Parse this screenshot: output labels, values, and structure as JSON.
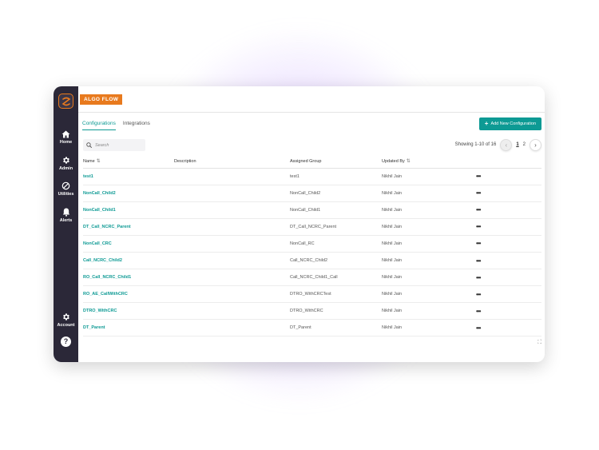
{
  "app": {
    "brand": "ALGO FLOW"
  },
  "sidebar": {
    "items": [
      {
        "label": "Home",
        "icon": "home-icon"
      },
      {
        "label": "Admin",
        "icon": "gear-icon"
      },
      {
        "label": "Utilities",
        "icon": "utilities-icon"
      },
      {
        "label": "Alerts",
        "icon": "bell-icon"
      }
    ],
    "account": {
      "label": "Account",
      "icon": "gear-icon"
    },
    "help": {
      "label": "?",
      "icon": "help-icon"
    }
  },
  "tabs": [
    {
      "label": "Configurations",
      "active": true
    },
    {
      "label": "Integrations",
      "active": false
    }
  ],
  "toolbar": {
    "add_label": "Add New Configuration",
    "add_icon": "+"
  },
  "search": {
    "placeholder": "Search",
    "value": ""
  },
  "pagination": {
    "showing": "Showing 1-10 of 16",
    "prev": "‹",
    "next": "›",
    "pages": [
      "1",
      "2"
    ],
    "current": "1"
  },
  "table": {
    "columns": [
      "Name",
      "Description",
      "Assigned Group",
      "Updated By",
      ""
    ],
    "sort_icon": "⇅",
    "action_icon": "•••",
    "rows": [
      {
        "name": "test1",
        "description": "",
        "group": "test1",
        "updated_by": "Nikhil Jain"
      },
      {
        "name": "NonCall_Child2",
        "description": "",
        "group": "NonCall_Child2",
        "updated_by": "Nikhil Jain"
      },
      {
        "name": "NonCall_Child1",
        "description": "",
        "group": "NonCall_Child1",
        "updated_by": "Nikhil Jain"
      },
      {
        "name": "DT_Call_NCRC_Parent",
        "description": "",
        "group": "DT_Call_NCRC_Parent",
        "updated_by": "Nikhil Jain"
      },
      {
        "name": "NonCall_CRC",
        "description": "",
        "group": "NonCall_RC",
        "updated_by": "Nikhil Jain"
      },
      {
        "name": "Call_NCRC_Child2",
        "description": "",
        "group": "Call_NCRC_Child2",
        "updated_by": "Nikhil Jain"
      },
      {
        "name": "RO_Call_NCRC_Child1",
        "description": "",
        "group": "Call_NCRC_Child1_Call",
        "updated_by": "Nikhil Jain"
      },
      {
        "name": "RO_AE_CallWithCRC",
        "description": "",
        "group": "DTRO_WithCRCTest",
        "updated_by": "Nikhil Jain"
      },
      {
        "name": "DTRO_WithCRC",
        "description": "",
        "group": "DTRO_WithCRC",
        "updated_by": "Nikhil Jain"
      },
      {
        "name": "DT_Parent",
        "description": "",
        "group": "DT_Parent",
        "updated_by": "Nikhil Jain"
      }
    ]
  },
  "colors": {
    "accent": "#0d9a94",
    "brand": "#e87a1e",
    "sidebar": "#2b2838"
  }
}
